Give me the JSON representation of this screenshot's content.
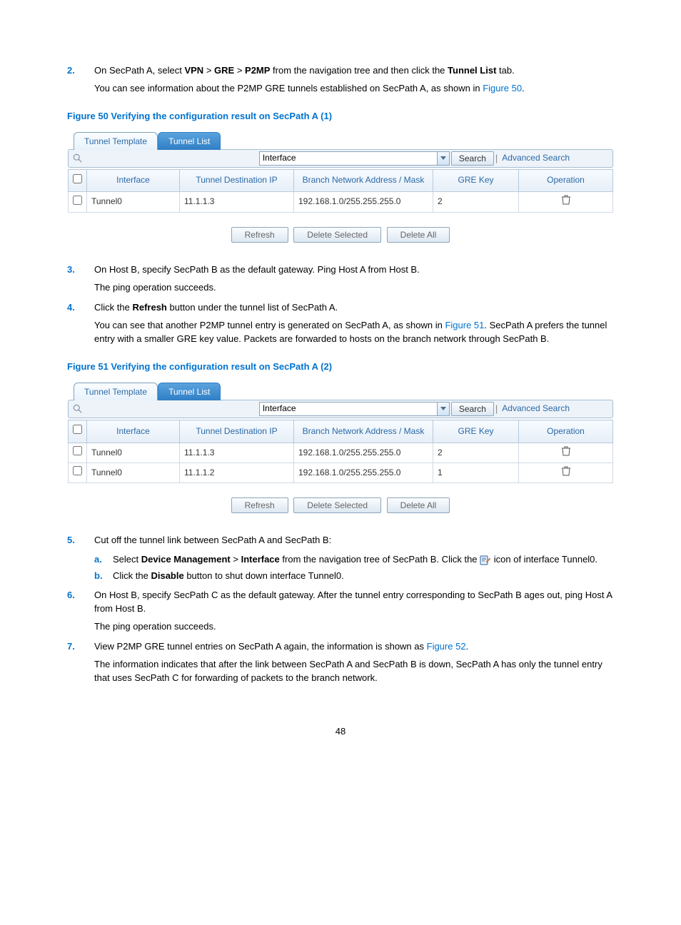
{
  "page_number": "48",
  "steps": {
    "s2": {
      "num": "2.",
      "line1_a": "On SecPath A, select ",
      "line1_vpn": "VPN",
      "line1_gt1": " > ",
      "line1_gre": "GRE",
      "line1_gt2": " > ",
      "line1_p2mp": "P2MP",
      "line1_b": " from the navigation tree and then click the ",
      "line1_tl": "Tunnel List",
      "line1_c": " tab.",
      "line2_a": "You can see information about the P2MP GRE tunnels established on SecPath A, as shown in ",
      "line2_link": "Figure 50",
      "line2_b": "."
    },
    "s3": {
      "num": "3.",
      "line1": "On Host B, specify SecPath B as the default gateway. Ping Host A from Host B.",
      "line2": "The ping operation succeeds."
    },
    "s4": {
      "num": "4.",
      "line1_a": "Click the ",
      "line1_b": "Refresh",
      "line1_c": " button under the tunnel list of SecPath A.",
      "line2_a": "You can see that another P2MP tunnel entry is generated on SecPath A, as shown in ",
      "line2_link": "Figure 51",
      "line2_b": ". SecPath A prefers the tunnel entry with a smaller GRE key value. Packets are forwarded to hosts on the branch network through SecPath B."
    },
    "s5": {
      "num": "5.",
      "line1": "Cut off the tunnel link between SecPath A and SecPath B:",
      "a": {
        "letter": "a.",
        "t1": "Select ",
        "b1": "Device Management",
        "t2": " > ",
        "b2": "Interface",
        "t3": " from the navigation tree of SecPath B. Click the ",
        "t4": " icon of interface Tunnel0."
      },
      "b": {
        "letter": "b.",
        "t1": "Click the ",
        "b1": "Disable",
        "t2": " button to shut down interface Tunnel0."
      }
    },
    "s6": {
      "num": "6.",
      "line1": "On Host B, specify SecPath C as the default gateway. After the tunnel entry corresponding to SecPath B ages out, ping Host A from Host B.",
      "line2": "The ping operation succeeds."
    },
    "s7": {
      "num": "7.",
      "line1_a": "View P2MP GRE tunnel entries on SecPath A again, the information is shown as ",
      "line1_link": "Figure 52",
      "line1_b": ".",
      "line2": "The information indicates that after the link between SecPath A and SecPath B is down, SecPath A has only the tunnel entry that uses SecPath C for forwarding of packets to the branch network."
    }
  },
  "fig50": {
    "caption": "Figure 50 Verifying the configuration result on SecPath A (1)",
    "tabs": {
      "template": "Tunnel Template",
      "list": "Tunnel List"
    },
    "search": {
      "field": "Interface",
      "btn": "Search",
      "adv": "Advanced Search"
    },
    "headers": {
      "c1": "Interface",
      "c2": "Tunnel Destination IP",
      "c3": "Branch Network Address / Mask",
      "c4": "GRE Key",
      "c5": "Operation"
    },
    "rows": [
      {
        "c1": "Tunnel0",
        "c2": "11.1.1.3",
        "c3": "192.168.1.0/255.255.255.0",
        "c4": "2"
      }
    ],
    "buttons": {
      "refresh": "Refresh",
      "delsel": "Delete Selected",
      "delall": "Delete All"
    }
  },
  "fig51": {
    "caption": "Figure 51 Verifying the configuration result on SecPath A (2)",
    "tabs": {
      "template": "Tunnel Template",
      "list": "Tunnel List"
    },
    "search": {
      "field": "Interface",
      "btn": "Search",
      "adv": "Advanced Search"
    },
    "headers": {
      "c1": "Interface",
      "c2": "Tunnel Destination IP",
      "c3": "Branch Network Address / Mask",
      "c4": "GRE Key",
      "c5": "Operation"
    },
    "rows": [
      {
        "c1": "Tunnel0",
        "c2": "11.1.1.3",
        "c3": "192.168.1.0/255.255.255.0",
        "c4": "2"
      },
      {
        "c1": "Tunnel0",
        "c2": "11.1.1.2",
        "c3": "192.168.1.0/255.255.255.0",
        "c4": "1"
      }
    ],
    "buttons": {
      "refresh": "Refresh",
      "delsel": "Delete Selected",
      "delall": "Delete All"
    }
  }
}
